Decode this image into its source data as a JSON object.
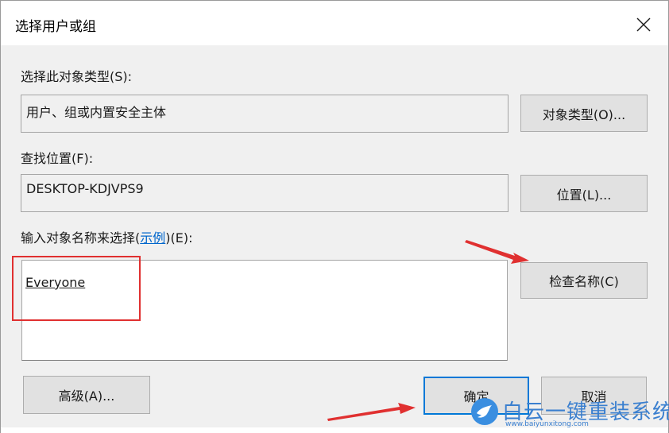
{
  "dialog": {
    "title": "选择用户或组"
  },
  "object_type": {
    "label": "选择此对象类型(S):",
    "value": "用户、组或内置安全主体",
    "button": "对象类型(O)..."
  },
  "location": {
    "label": "查找位置(F):",
    "value": "DESKTOP-KDJVPS9",
    "button": "位置(L)..."
  },
  "names": {
    "label_prefix": "输入对象名称来选择(",
    "label_link": "示例",
    "label_suffix": ")(E):",
    "value": "Everyone",
    "check_button": "检查名称(C)"
  },
  "footer": {
    "advanced_button": "高级(A)...",
    "ok_button": "确定",
    "cancel_button": "取消"
  },
  "watermark": {
    "brand": "白云一键重装系统",
    "url": "www.baiyunxitong.com"
  },
  "colors": {
    "annotation_red": "#e03030",
    "accent_blue": "#0078d7",
    "link_blue": "#0066cc"
  }
}
